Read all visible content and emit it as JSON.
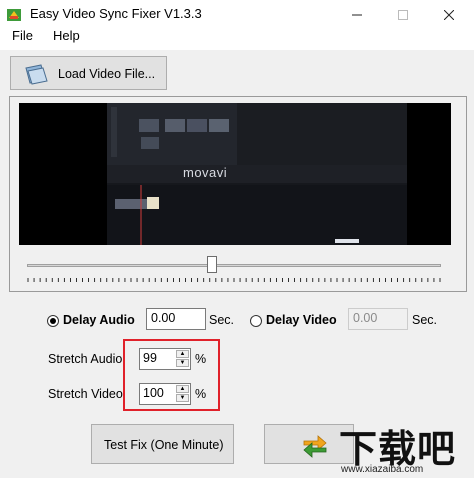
{
  "window": {
    "title": "Easy Video Sync Fixer V1.3.3"
  },
  "menu": {
    "file": "File",
    "help": "Help"
  },
  "toolbar": {
    "load_label": "Load Video File..."
  },
  "preview": {
    "brand": "movavi"
  },
  "delay": {
    "audio_label": "Delay Audio",
    "audio_value": "0.00",
    "audio_unit": "Sec.",
    "audio_selected": true,
    "video_label": "Delay Video",
    "video_value": "0.00",
    "video_unit": "Sec."
  },
  "stretch": {
    "audio_label": "Stretch Audio",
    "audio_value": "99",
    "audio_unit": "%",
    "video_label": "Stretch Video",
    "video_value": "100",
    "video_unit": "%"
  },
  "actions": {
    "test_label": "Test Fix (One Minute)"
  },
  "watermark": {
    "text": "下载吧",
    "url": "www.xiazaiba.com"
  },
  "colors": {
    "highlight": "#e0212a",
    "accent": "#e8a020"
  }
}
